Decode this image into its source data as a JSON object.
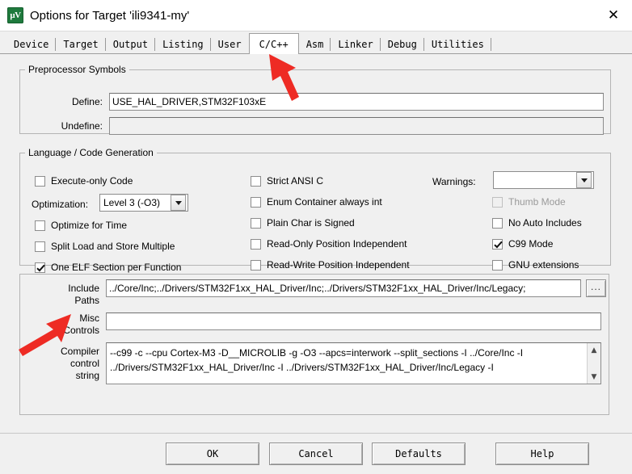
{
  "window": {
    "title": "Options for Target 'ili9341-my'",
    "icon": "keil-uvision-icon",
    "icon_glyph": "µV",
    "close_label": "✕"
  },
  "tabs": [
    {
      "label": "Device",
      "selected": false
    },
    {
      "label": "Target",
      "selected": false
    },
    {
      "label": "Output",
      "selected": false
    },
    {
      "label": "Listing",
      "selected": false
    },
    {
      "label": "User",
      "selected": false
    },
    {
      "label": "C/C++",
      "selected": true
    },
    {
      "label": "Asm",
      "selected": false
    },
    {
      "label": "Linker",
      "selected": false
    },
    {
      "label": "Debug",
      "selected": false
    },
    {
      "label": "Utilities",
      "selected": false
    }
  ],
  "preprocessor": {
    "legend": "Preprocessor Symbols",
    "define_label": "Define:",
    "define_value": "USE_HAL_DRIVER,STM32F103xE",
    "undefine_label": "Undefine:",
    "undefine_value": ""
  },
  "language": {
    "legend": "Language / Code Generation",
    "col1": [
      {
        "label": "Execute-only Code",
        "checked": false,
        "enabled": true
      },
      {
        "label": "Optimize for Time",
        "checked": false,
        "enabled": true
      },
      {
        "label": "Split Load and Store Multiple",
        "checked": false,
        "enabled": true
      },
      {
        "label": "One ELF Section per Function",
        "checked": true,
        "enabled": true
      }
    ],
    "optimization_label": "Optimization:",
    "optimization_value": "Level 3 (-O3)",
    "col2": [
      {
        "label": "Strict ANSI C",
        "checked": false,
        "enabled": true
      },
      {
        "label": "Enum Container always int",
        "checked": false,
        "enabled": true
      },
      {
        "label": "Plain Char is Signed",
        "checked": false,
        "enabled": true
      },
      {
        "label": "Read-Only Position Independent",
        "checked": false,
        "enabled": true
      },
      {
        "label": "Read-Write Position Independent",
        "checked": false,
        "enabled": true
      }
    ],
    "warnings_label": "Warnings:",
    "warnings_value": "",
    "col3": [
      {
        "label": "Thumb Mode",
        "checked": false,
        "enabled": false
      },
      {
        "label": "No Auto Includes",
        "checked": false,
        "enabled": true
      },
      {
        "label": "C99 Mode",
        "checked": true,
        "enabled": true
      },
      {
        "label": "GNU extensions",
        "checked": false,
        "enabled": true
      }
    ]
  },
  "paths": {
    "include_label_line1": "Include",
    "include_label_line2": "Paths",
    "include_value": "../Core/Inc;../Drivers/STM32F1xx_HAL_Driver/Inc;../Drivers/STM32F1xx_HAL_Driver/Inc/Legacy;",
    "browse_label": "...",
    "misc_label_line1": "Misc",
    "misc_label_line2": "Controls",
    "misc_value": "",
    "compiler_label_line1": "Compiler",
    "compiler_label_line2": "control",
    "compiler_label_line3": "string",
    "compiler_value": "--c99 -c --cpu Cortex-M3 -D__MICROLIB -g -O3 --apcs=interwork --split_sections -I ../Core/Inc -I\n../Drivers/STM32F1xx_HAL_Driver/Inc -I ../Drivers/STM32F1xx_HAL_Driver/Inc/Legacy -I",
    "scroll_up": "▲",
    "scroll_down": "▼"
  },
  "buttons": {
    "ok": "OK",
    "cancel": "Cancel",
    "defaults": "Defaults",
    "help": "Help"
  },
  "annotations": {
    "accent_color": "#ee2b24",
    "arrow_tab_target": "C/C++ tab",
    "arrow_include_target": "Include Paths"
  }
}
